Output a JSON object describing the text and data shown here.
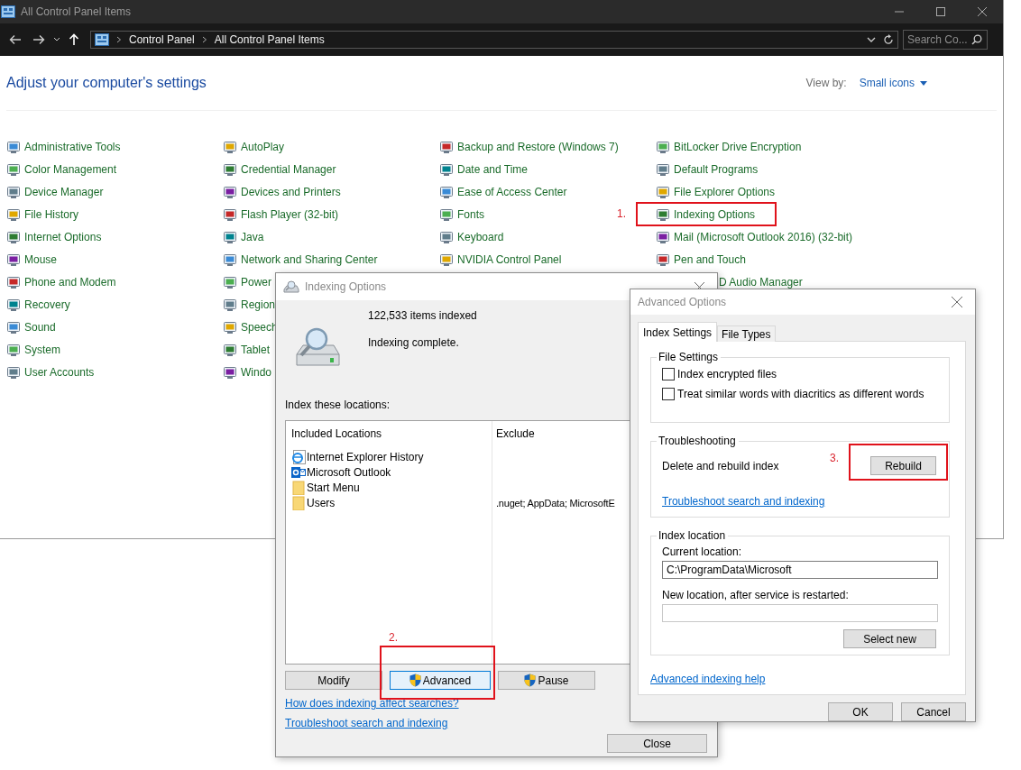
{
  "window": {
    "title": "All Control Panel Items"
  },
  "address_bar": {
    "crumbs": [
      "Control Panel",
      "All Control Panel Items"
    ]
  },
  "search": {
    "placeholder": "Search Co..."
  },
  "heading": "Adjust your computer's settings",
  "view_by": {
    "label": "View by:",
    "value": "Small icons"
  },
  "item_columns": [
    [
      {
        "label": "Administrative Tools"
      },
      {
        "label": "Color Management"
      },
      {
        "label": "Device Manager"
      },
      {
        "label": "File History"
      },
      {
        "label": "Internet Options"
      },
      {
        "label": "Mouse"
      },
      {
        "label": "Phone and Modem"
      },
      {
        "label": "Recovery"
      },
      {
        "label": "Sound"
      },
      {
        "label": "System"
      },
      {
        "label": "User Accounts"
      }
    ],
    [
      {
        "label": "AutoPlay"
      },
      {
        "label": "Credential Manager"
      },
      {
        "label": "Devices and Printers"
      },
      {
        "label": "Flash Player (32-bit)"
      },
      {
        "label": "Java"
      },
      {
        "label": "Network and Sharing Center"
      },
      {
        "label": "Power"
      },
      {
        "label": "Region"
      },
      {
        "label": "Speech"
      },
      {
        "label": "Tablet"
      },
      {
        "label": "Windo"
      }
    ],
    [
      {
        "label": "Backup and Restore (Windows 7)"
      },
      {
        "label": "Date and Time"
      },
      {
        "label": "Ease of Access Center"
      },
      {
        "label": "Fonts"
      },
      {
        "label": "Keyboard"
      },
      {
        "label": "NVIDIA Control Panel"
      }
    ],
    [
      {
        "label": "BitLocker Drive Encryption"
      },
      {
        "label": "Default Programs"
      },
      {
        "label": "File Explorer Options"
      },
      {
        "label": "Indexing Options",
        "callout": "1."
      },
      {
        "label": "Mail (Microsoft Outlook 2016) (32-bit)"
      },
      {
        "label": "Pen and Touch"
      },
      {
        "label": "D Audio Manager",
        "kind": "clipped"
      }
    ]
  ],
  "indexing_dialog": {
    "title": "Indexing Options",
    "count": "122,533 items indexed",
    "status": "Indexing complete.",
    "locations_label": "Index these locations:",
    "columns": [
      "Included Locations",
      "Exclude"
    ],
    "rows": [
      {
        "kind": "browser",
        "location": "Internet Explorer History"
      },
      {
        "kind": "mail",
        "location": "Microsoft Outlook"
      },
      {
        "kind": "folder",
        "location": "Start Menu"
      },
      {
        "kind": "folder",
        "location": "Users",
        "exclude": ".nuget; AppData; MicrosoftE"
      }
    ],
    "buttons": [
      {
        "label": "Modify",
        "shield": false,
        "focused": false
      },
      {
        "label": "Advanced",
        "shield": true,
        "focused": true,
        "callout": "2."
      },
      {
        "label": "Pause",
        "shield": true,
        "focused": false
      }
    ],
    "links": [
      "How does indexing affect searches?",
      "Troubleshoot search and indexing"
    ],
    "close_button": "Close"
  },
  "advanced_dialog": {
    "title": "Advanced Options",
    "tabs": [
      {
        "label": "Index Settings",
        "selected": true
      },
      {
        "label": "File Types",
        "selected": false
      }
    ],
    "file_settings": {
      "title": "File Settings",
      "checkboxes": [
        {
          "label": "Index encrypted files",
          "checked": false
        },
        {
          "label": "Treat similar words with diacritics as different words",
          "checked": false
        }
      ]
    },
    "troubleshooting": {
      "title": "Troubleshooting",
      "text": "Delete and rebuild index",
      "button": "Rebuild",
      "callout": "3.",
      "link": "Troubleshoot search and indexing"
    },
    "index_location": {
      "title": "Index location",
      "current_label": "Current location:",
      "current_value": "C:\\ProgramData\\Microsoft",
      "new_label": "New location, after service is restarted:",
      "button": "Select new"
    },
    "help_link": "Advanced indexing help",
    "buttons": [
      "OK",
      "Cancel"
    ]
  }
}
